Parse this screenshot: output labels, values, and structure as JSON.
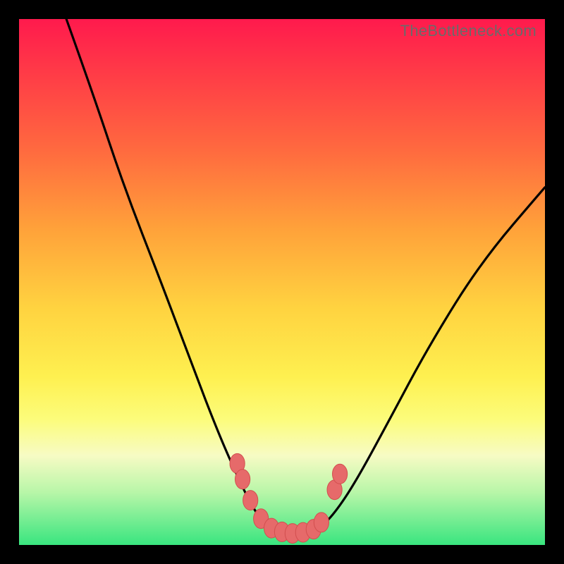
{
  "watermark": "TheBottleneck.com",
  "colors": {
    "frame": "#000000",
    "curve": "#000000",
    "marker_fill": "#e66a6a",
    "marker_stroke": "#d24f4f"
  },
  "chart_data": {
    "type": "line",
    "title": "",
    "xlabel": "",
    "ylabel": "",
    "xlim": [
      0,
      100
    ],
    "ylim": [
      0,
      100
    ],
    "background_meaning": "vertical gradient: top = high bottleneck (red), bottom = low bottleneck (green)",
    "curve": {
      "description": "Asymmetric V-shaped bottleneck curve; minimum plateau between x≈46 and x≈58",
      "points_xy_percent": [
        [
          9,
          100
        ],
        [
          14,
          86
        ],
        [
          20,
          68
        ],
        [
          27,
          50
        ],
        [
          33,
          34
        ],
        [
          38,
          21
        ],
        [
          42,
          12
        ],
        [
          45,
          6
        ],
        [
          48,
          3
        ],
        [
          51,
          2
        ],
        [
          54,
          2
        ],
        [
          57,
          3
        ],
        [
          60,
          6
        ],
        [
          64,
          12
        ],
        [
          70,
          23
        ],
        [
          78,
          38
        ],
        [
          88,
          54
        ],
        [
          100,
          68
        ]
      ]
    },
    "markers": {
      "description": "salmon dots near minimum of curve and on rising edges",
      "points_xy_percent": [
        [
          41.5,
          15.5
        ],
        [
          42.5,
          12.5
        ],
        [
          44,
          8.5
        ],
        [
          46,
          5
        ],
        [
          48,
          3.2
        ],
        [
          50,
          2.5
        ],
        [
          52,
          2.2
        ],
        [
          54,
          2.4
        ],
        [
          56,
          3
        ],
        [
          57.5,
          4.3
        ],
        [
          60,
          10.5
        ],
        [
          61,
          13.5
        ]
      ],
      "radius_percent": 1.5
    }
  }
}
